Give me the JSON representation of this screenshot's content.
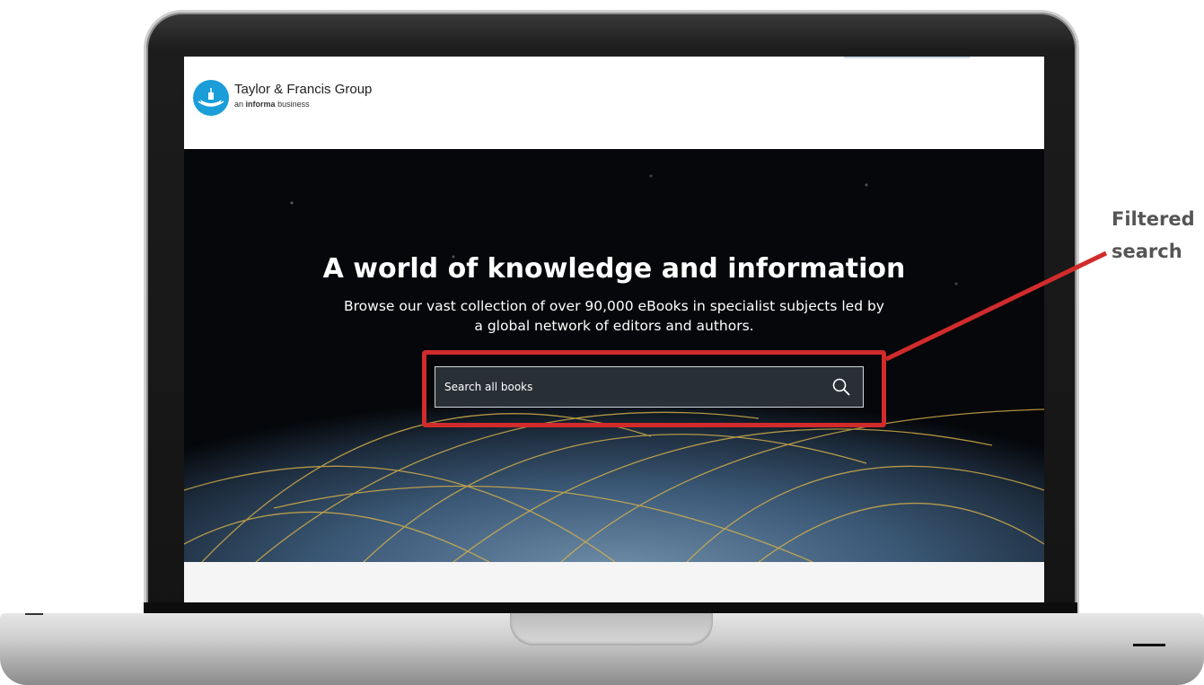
{
  "header": {
    "brand_name": "Taylor & Francis Group",
    "brand_sub_prefix": "an",
    "brand_sub_bold": "informa",
    "brand_sub_suffix": "business"
  },
  "hero": {
    "title": "A world of knowledge and information",
    "subtitle": "Browse our vast collection of over 90,000 eBooks in specialist subjects led by a global network of editors and authors."
  },
  "search": {
    "placeholder": "Search all books",
    "icon": "search-icon"
  },
  "annotation": {
    "line1": "Filtered",
    "line2": "search",
    "color": "#d12b2b"
  },
  "colors": {
    "brand": "#1a9dd9",
    "hero_bg": "#05070a",
    "arc": "#d9b24a"
  }
}
